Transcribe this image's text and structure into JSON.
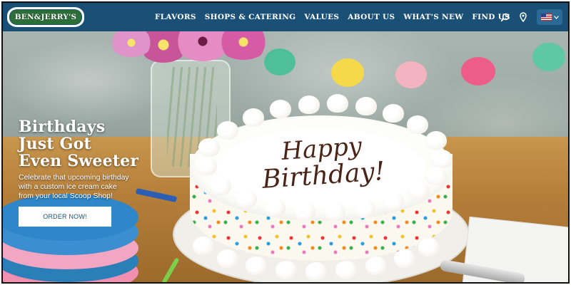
{
  "brand": {
    "logo_text": "BEN&JERRY'S"
  },
  "nav": {
    "items": [
      "FLAVORS",
      "SHOPS & CATERING",
      "VALUES",
      "ABOUT US",
      "WHAT'S NEW",
      "FIND US"
    ]
  },
  "header_icons": {
    "search": "search-icon",
    "location": "location-pin-icon",
    "locale": "us-flag-icon",
    "chevron": "chevron-down-icon"
  },
  "hero": {
    "title_lines": [
      "Birthdays",
      "Just Got",
      "Even Sweeter"
    ],
    "description_lines": [
      "Celebrate that upcoming birthday",
      "with a custom ice cream cake",
      "from your local Scoop Shop!"
    ],
    "cta_label": "ORDER NOW!",
    "cake_text_line1": "Happy",
    "cake_text_line2": "Birthday!"
  },
  "colors": {
    "header_bg": "#1b5076",
    "button_text": "#1d4f73",
    "hero_text": "#ffffff"
  }
}
